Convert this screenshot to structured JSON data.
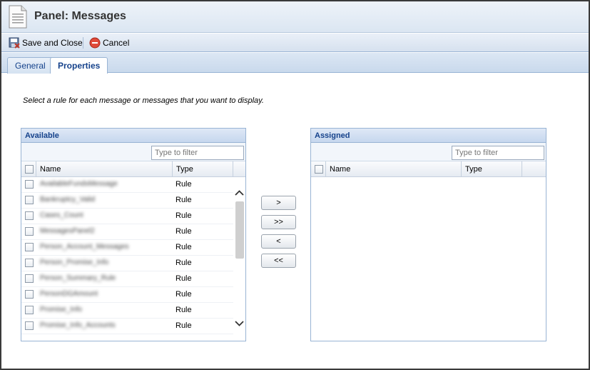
{
  "header": {
    "title": "Panel: Messages",
    "icon": "document-icon"
  },
  "toolbar": {
    "save_close_label": "Save and Close",
    "cancel_label": "Cancel"
  },
  "tabs": [
    {
      "label": "General",
      "active": false
    },
    {
      "label": "Properties",
      "active": true
    }
  ],
  "instructions": "Select a rule for each message or messages that you want to display.",
  "available": {
    "title": "Available",
    "filter_placeholder": "Type to filter",
    "columns": {
      "name": "Name",
      "type": "Type"
    },
    "rows": [
      {
        "name": "AvailableFundsMessage",
        "type": "Rule"
      },
      {
        "name": "Bankruptcy_Valid",
        "type": "Rule"
      },
      {
        "name": "Cases_Count",
        "type": "Rule"
      },
      {
        "name": "MessagesPanel2",
        "type": "Rule"
      },
      {
        "name": "Person_Account_Messages",
        "type": "Rule"
      },
      {
        "name": "Person_Promise_Info",
        "type": "Rule"
      },
      {
        "name": "Person_Summary_Rule",
        "type": "Rule"
      },
      {
        "name": "PersonDGAmount",
        "type": "Rule"
      },
      {
        "name": "Promise_Info",
        "type": "Rule"
      },
      {
        "name": "Promise_Info_Accounts",
        "type": "Rule"
      }
    ]
  },
  "assigned": {
    "title": "Assigned",
    "filter_placeholder": "Type to filter",
    "columns": {
      "name": "Name",
      "type": "Type"
    }
  },
  "move_buttons": {
    "add": ">",
    "add_all": ">>",
    "remove": "<",
    "remove_all": "<<"
  },
  "colors": {
    "accent": "#15428b",
    "border": "#99b4d4"
  }
}
